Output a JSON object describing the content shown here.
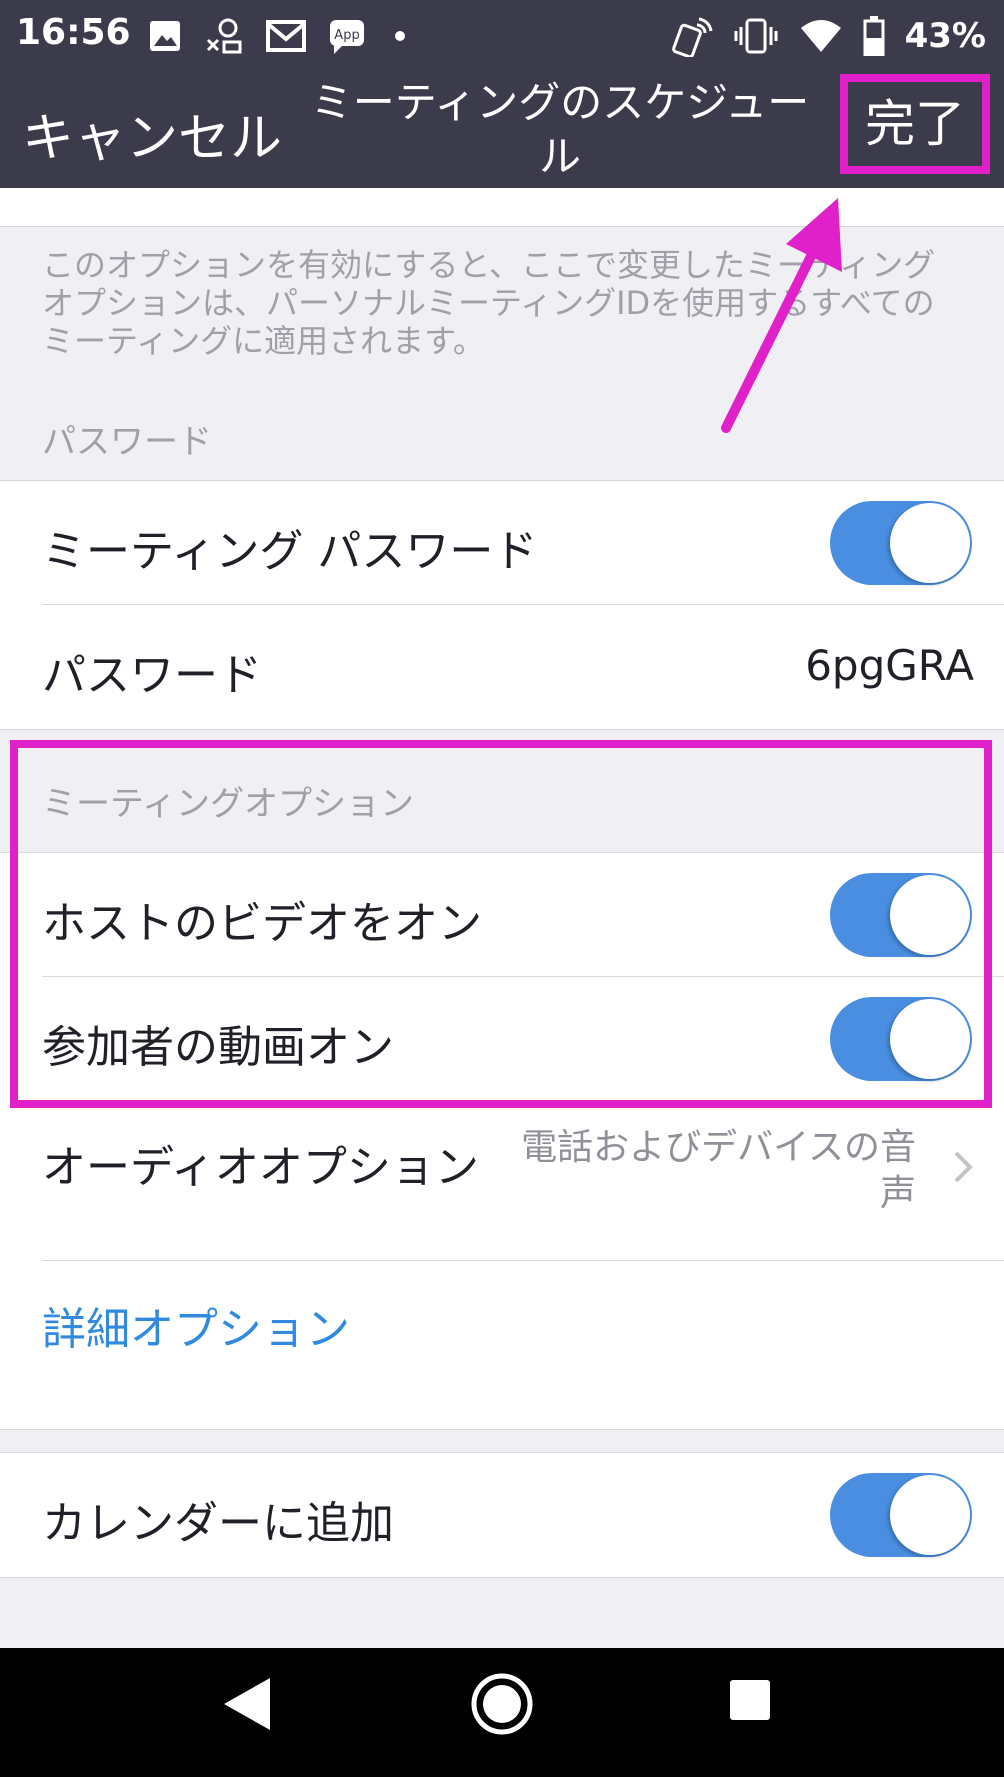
{
  "status_bar": {
    "time": "16:56",
    "battery": "43%",
    "left_icons": [
      "image-icon",
      "notification-icon",
      "gmail-icon",
      "app-icon",
      "dot-icon"
    ],
    "right_icons": [
      "nfc-icon",
      "vibrate-icon",
      "wifi-icon",
      "battery-icon"
    ]
  },
  "header": {
    "cancel_label": "キャンセル",
    "title": "ミーティングのスケジュール",
    "done_label": "完了"
  },
  "pmi_note": "このオプションを有効にすると、ここで変更したミーティングオプションは、パーソナルミーティングIDを使用するすべてのミーティングに適用されます。",
  "password_section": {
    "header": "パスワード",
    "meeting_password_label": "ミーティング パスワード",
    "meeting_password_on": true,
    "password_label": "パスワード",
    "password_value": "6pgGRA"
  },
  "meeting_options": {
    "header": "ミーティングオプション",
    "host_video_label": "ホストのビデオをオン",
    "host_video_on": true,
    "participant_video_label": "参加者の動画オン",
    "participant_video_on": true,
    "audio_label": "オーディオオプション",
    "audio_value": "電話およびデバイスの音声",
    "advanced_label": "詳細オプション"
  },
  "calendar": {
    "label": "カレンダーに追加",
    "on": true
  },
  "colors": {
    "header_bg": "#3b3b4c",
    "toggle_on": "#4a8ee2",
    "link": "#2f8ae0",
    "highlight": "#e020c8"
  },
  "nav_bar": {
    "icons": [
      "back-icon",
      "home-icon",
      "recents-icon"
    ]
  }
}
